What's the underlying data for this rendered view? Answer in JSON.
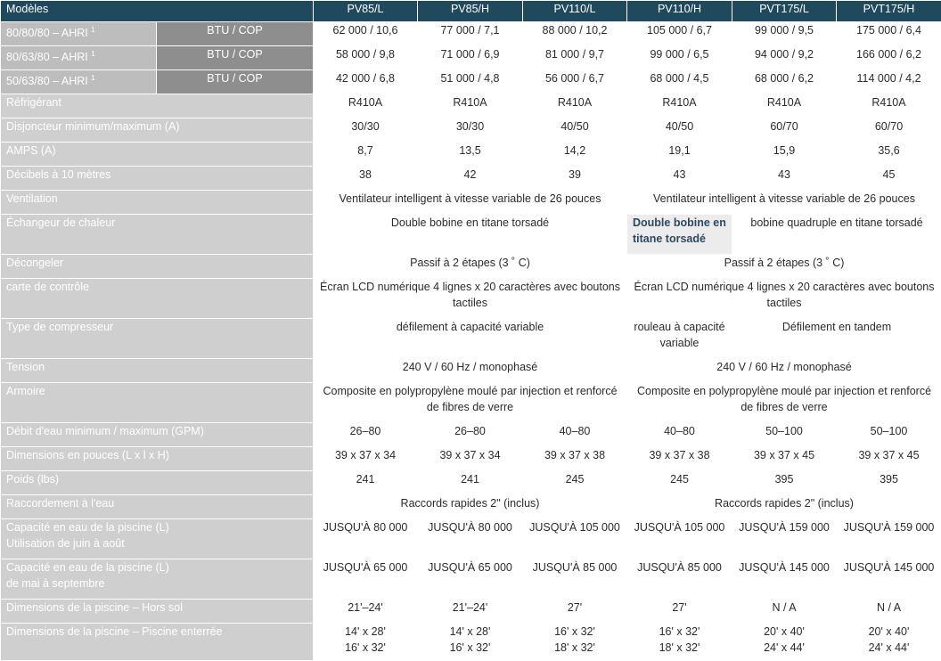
{
  "header": {
    "label": "Modèles",
    "models": [
      "PV85/L",
      "PV85/H",
      "PV110/L",
      "PV110/H",
      "PVT175/L",
      "PVT175/H"
    ]
  },
  "btu_rows": [
    {
      "label": "80/80/80 – AHRI",
      "sup": "1",
      "unit": "BTU / COP",
      "values": [
        "62 000 / 10,6",
        "77 000 / 7,1",
        "88 000 / 10,2",
        "105 000 / 6,7",
        "99 000 / 9,5",
        "175 000 / 6,4"
      ]
    },
    {
      "label": "80/63/80 – AHRI",
      "sup": "1",
      "unit": "BTU / COP",
      "values": [
        "58 000 / 9,8",
        "71 000 / 6,9",
        "81 000 / 9,7",
        "99 000 / 6,5",
        "94 000 / 9,2",
        "166 000 / 6,2"
      ]
    },
    {
      "label": "50/63/80 – AHRI",
      "sup": "1",
      "unit": "BTU / COP",
      "values": [
        "42 000 / 6,8",
        "51 000 / 4,8",
        "56 000 / 6,7",
        "68 000 / 4,5",
        "68 000 / 6,2",
        "114 000 / 4,2"
      ]
    }
  ],
  "refrigerant": {
    "label": "Réfrigérant",
    "values": [
      "R410A",
      "R410A",
      "R410A",
      "R410A",
      "R410A",
      "R410A"
    ]
  },
  "breaker": {
    "label": "Disjoncteur minimum/maximum (A)",
    "values": [
      "30/30",
      "30/30",
      "40/50",
      "40/50",
      "60/70",
      "60/70"
    ]
  },
  "amps": {
    "label": "AMPS (A)",
    "values": [
      "8,7",
      "13,5",
      "14,2",
      "19,1",
      "15,9",
      "35,6"
    ]
  },
  "decibels": {
    "label": "Décibels à 10 mètres",
    "values": [
      "38",
      "42",
      "39",
      "43",
      "43",
      "45"
    ]
  },
  "ventilation": {
    "label": "Ventilation",
    "left": "Ventilateur intelligent à vitesse variable de 26 pouces",
    "right": "Ventilateur intelligent à vitesse variable de 26 pouces"
  },
  "exchanger": {
    "label": "Échangeur de chaleur",
    "left": "Double bobine en titane torsadé",
    "mid": "Double bobine en titane torsadé",
    "right": "bobine quadruple en titane torsadé"
  },
  "defrost": {
    "label": "Décongeler",
    "left": "Passif à 2 étapes (3 ˚ C)",
    "right": "Passif à 2 étapes (3 ˚ C)"
  },
  "control": {
    "label": "carte de contrôle",
    "left": "Écran LCD numérique 4 lignes x 20 caractères avec boutons tactiles",
    "right": "Écran LCD numérique 4 lignes x 20 caractères avec boutons tactiles"
  },
  "compressor": {
    "label": "Type de compresseur",
    "left": "défilement à capacité variable",
    "mid": "rouleau à capacité variable",
    "right": "Défilement en tandem"
  },
  "voltage": {
    "label": "Tension",
    "left": "240 V / 60 Hz / monophasé",
    "right": "240 V / 60 Hz / monophasé"
  },
  "cabinet": {
    "label": "Armoire",
    "left": "Composite en polypropylène moulé par injection et renforcé de fibres de verre",
    "right": "Composite en polypropylène moulé par injection et renforcé de fibres de verre"
  },
  "flow": {
    "label": "Débit d'eau minimum / maximum (GPM)",
    "values": [
      "26–80",
      "26–80",
      "40–80",
      "40–80",
      "50–100",
      "50–100"
    ]
  },
  "dimensions": {
    "label": "Dimensions en pouces (L x l x H)",
    "values": [
      "39 x 37 x 34",
      "39 x 37 x 34",
      "39 x 37 x 38",
      "39 x 37 x 38",
      "39 x 37 x 45",
      "39 x 37 x 45"
    ]
  },
  "weight": {
    "label": "Poids (lbs)",
    "values": [
      "241",
      "241",
      "245",
      "245",
      "395",
      "395"
    ]
  },
  "connection": {
    "label": "Raccordement à l'eau",
    "left": "Raccords rapides 2\" (inclus)",
    "right": "Raccords rapides 2\" (inclus)"
  },
  "capacity_june": {
    "label_line1": "Capacité en eau de la piscine (L)",
    "label_line2": "Utilisation de juin à août",
    "values": [
      "JUSQU'À 80 000",
      "JUSQU'À 80 000",
      "JUSQU'À 105 000",
      "JUSQU'À 105 000",
      "JUSQU'À 159 000",
      "JUSQU'À 159 000"
    ]
  },
  "capacity_may": {
    "label_line1": "Capacité en eau de la piscine (L)",
    "label_line2": "de mai à septembre",
    "values": [
      "JUSQU'À 65 000",
      "JUSQU'À 65 000",
      "JUSQU'À 85 000",
      "JUSQU'À 85 000",
      "JUSQU'À 145 000",
      "JUSQU'À 145 000"
    ]
  },
  "pool_above": {
    "label": "Dimensions de la piscine – Hors sol",
    "values": [
      "21'–24'",
      "21'–24'",
      "27'",
      "27'",
      "N / A",
      "N / A"
    ]
  },
  "pool_inground": {
    "label": "Dimensions de la piscine – Piscine enterrée",
    "line1": [
      "14' x 28'",
      "14' x 28'",
      "16' x 32'",
      "16' x 32'",
      "20' x 40'",
      "20' x 40'"
    ],
    "line2": [
      "16' x 32'",
      "16' x 32'",
      "18' x 32'",
      "18' x 32'",
      "24' x 44'",
      "24' x 44'"
    ]
  }
}
